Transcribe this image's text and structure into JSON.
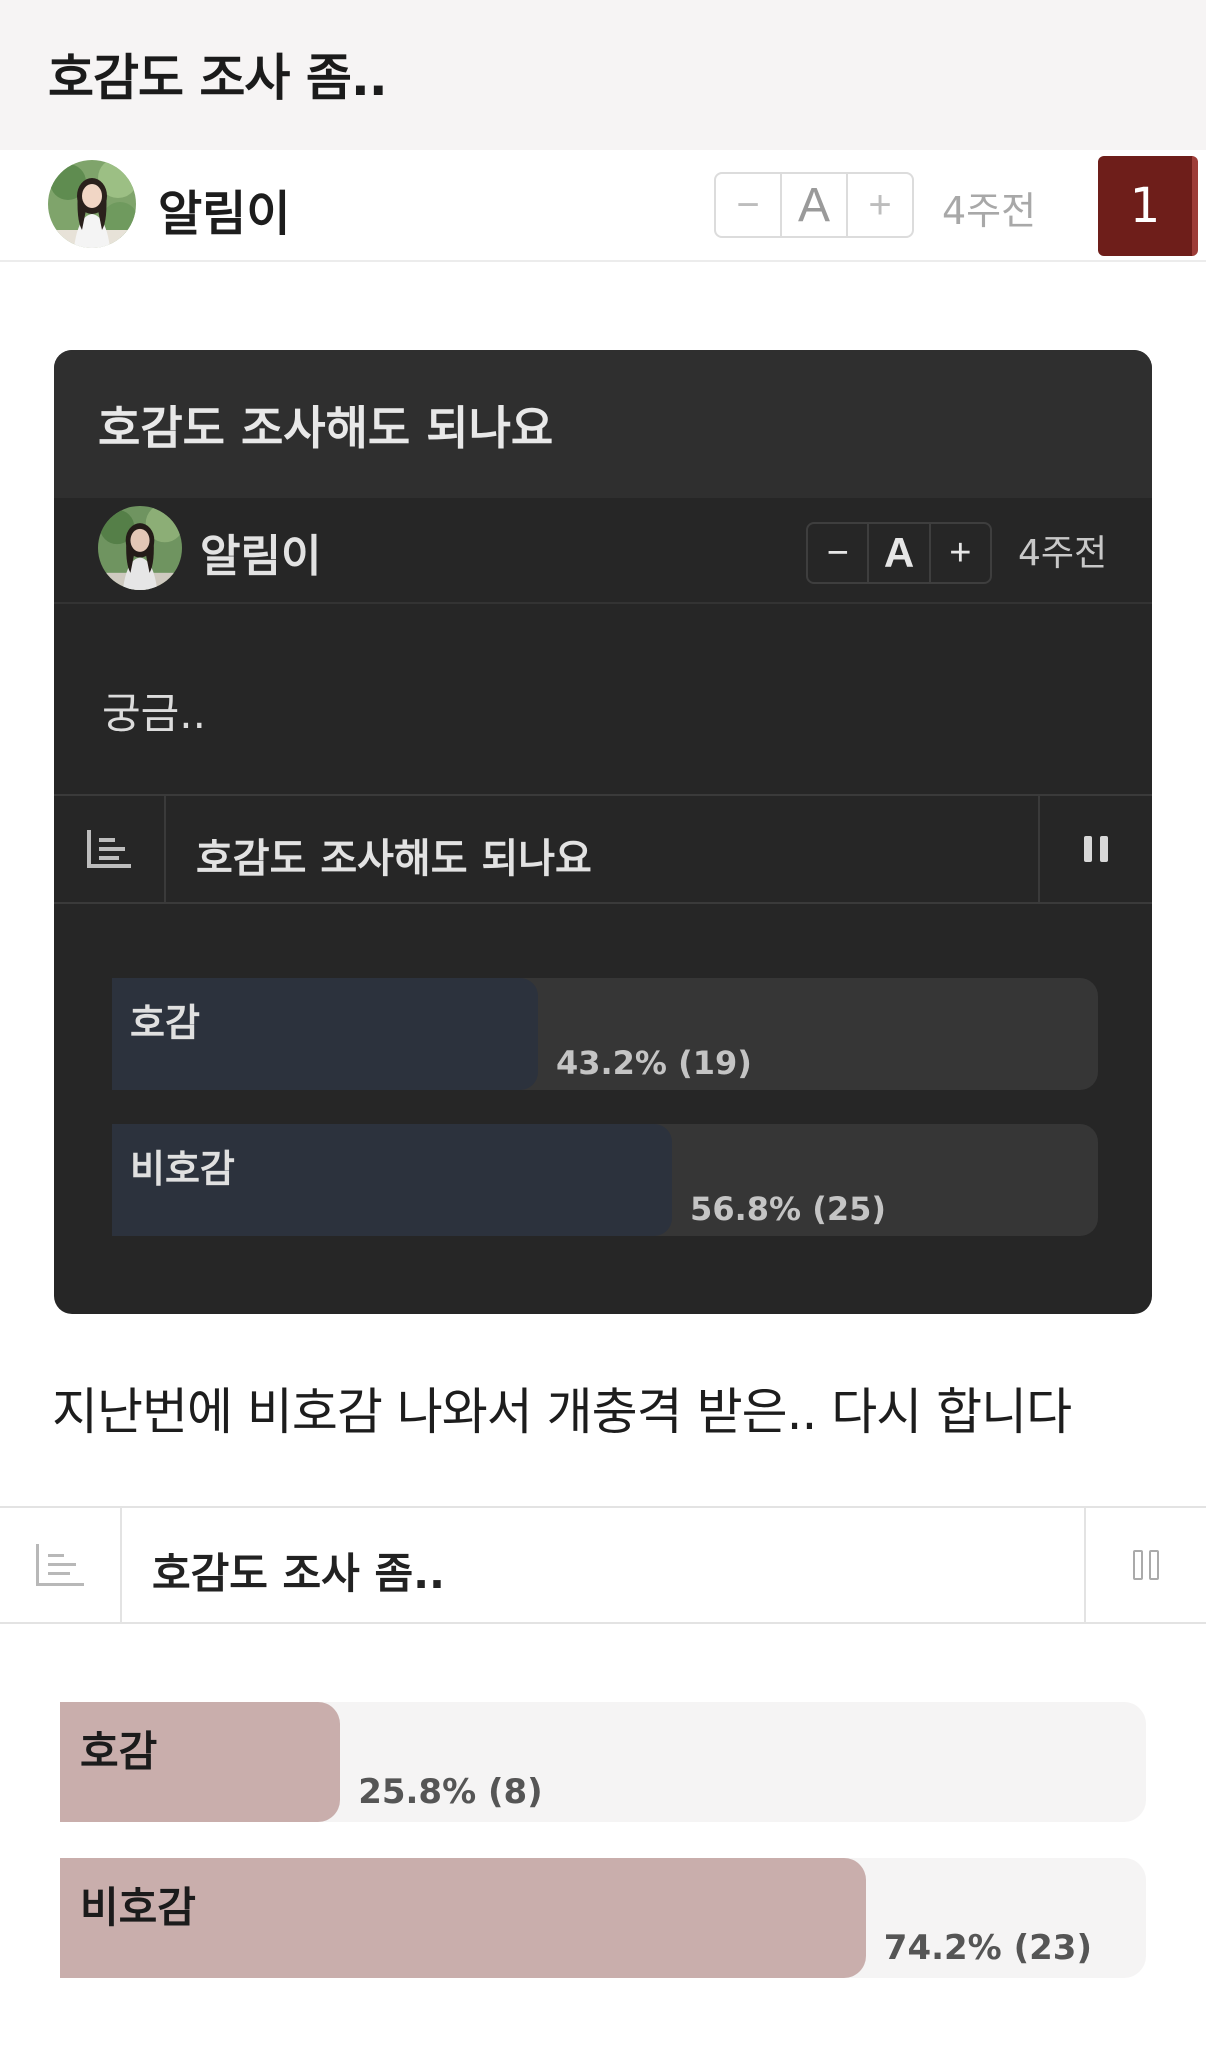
{
  "post": {
    "title": "호감도 조사 좀..",
    "author": "알림이",
    "time": "4주전",
    "comment_count": "1",
    "font_controls": {
      "minus": "−",
      "a": "A",
      "plus": "+"
    },
    "body": "지난번에 비호감 나와서 개충격 받은.. 다시 합니다"
  },
  "embedded": {
    "title": "호감도 조사해도 되나요",
    "author": "알림이",
    "time": "4주전",
    "font_controls": {
      "minus": "−",
      "a": "A",
      "plus": "+"
    },
    "body": "궁금..",
    "poll": {
      "title": "호감도 조사해도 되나요",
      "options": [
        {
          "label": "호감",
          "pct_text": "43.2% (19)",
          "fraction": 0.432
        },
        {
          "label": "비호감",
          "pct_text": "56.8% (25)",
          "fraction": 0.568
        }
      ]
    }
  },
  "poll": {
    "title": "호감도 조사 좀..",
    "options": [
      {
        "label": "호감",
        "pct_text": "25.8% (8)",
        "fraction": 0.258
      },
      {
        "label": "비호감",
        "pct_text": "74.2% (23)",
        "fraction": 0.742
      }
    ]
  },
  "colors": {
    "badge": "#6e1e1a",
    "poll_fill": "#c9aeac",
    "dark_poll_fill": "#2c323d"
  },
  "icons": [
    "avatar-photo",
    "poll-list-icon",
    "pause-icon"
  ]
}
